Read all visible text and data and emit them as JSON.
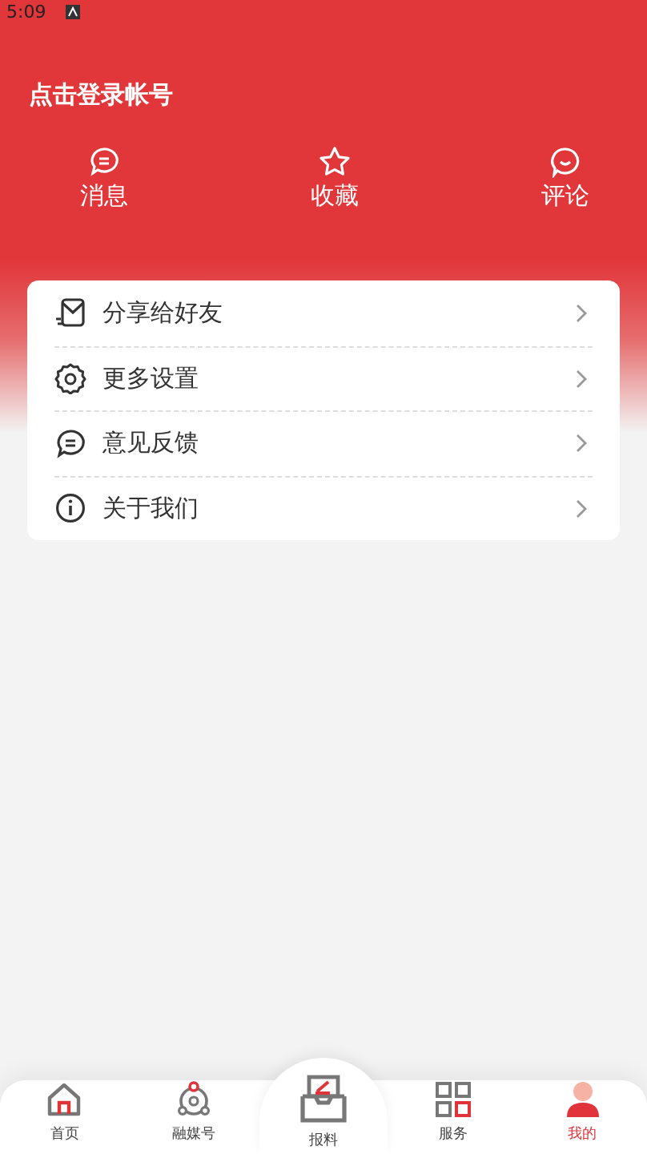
{
  "status_bar": {
    "time": "5:09"
  },
  "header": {
    "login_prompt": "点击登录帐号"
  },
  "shortcuts": [
    {
      "kind": "message",
      "label": "消息"
    },
    {
      "kind": "star",
      "label": "收藏"
    },
    {
      "kind": "comment",
      "label": "评论"
    }
  ],
  "menu": [
    {
      "kind": "share",
      "label": "分享给好友"
    },
    {
      "kind": "settings",
      "label": "更多设置"
    },
    {
      "kind": "feedback",
      "label": "意见反馈"
    },
    {
      "kind": "about",
      "label": "关于我们"
    }
  ],
  "tab_bar": [
    {
      "kind": "home",
      "label": "首页",
      "selected": false
    },
    {
      "kind": "media",
      "label": "融媒号",
      "selected": false
    },
    {
      "kind": "report",
      "label": "报料",
      "selected": false
    },
    {
      "kind": "services",
      "label": "服务",
      "selected": false
    },
    {
      "kind": "profile",
      "label": "我的",
      "selected": true
    }
  ]
}
